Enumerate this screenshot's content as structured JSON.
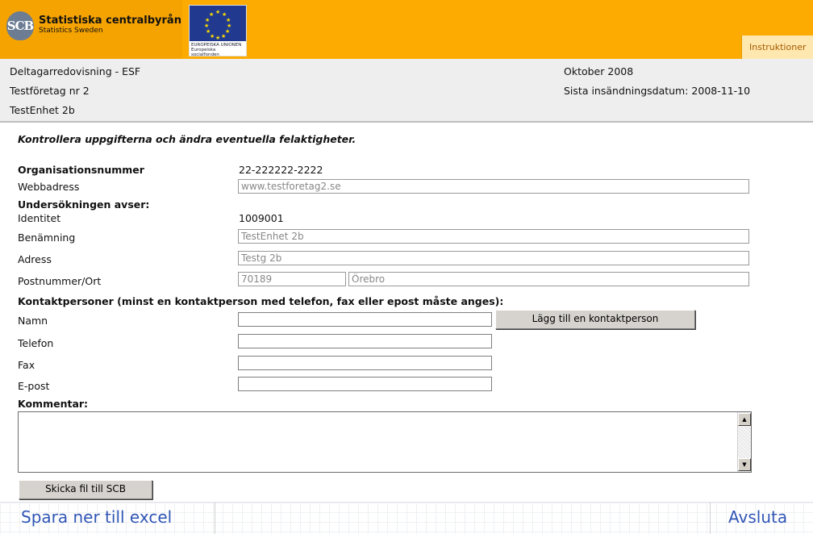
{
  "header": {
    "logo_mark": "SCB",
    "org_name": "Statistiska centralbyrån",
    "org_sub": "Statistics Sweden",
    "eu_text": "EUROPEISKA UNIONEN Europeiska socialfonden",
    "instructions_tab": "Instruktioner",
    "colors": {
      "banner": "#fdab00",
      "eu_blue": "#213a8f",
      "link": "#3056b5"
    }
  },
  "info": {
    "survey": "Deltagarredovisning - ESF",
    "company": "Testföretag nr 2",
    "unit": "TestEnhet 2b",
    "period": "Oktober 2008",
    "deadline": "Sista insändningsdatum: 2008-11-10"
  },
  "form": {
    "intro": "Kontrollera uppgifterna och ändra eventuella felaktigheter.",
    "org_nr_label": "Organisationsnummer",
    "org_nr_value": "22-222222-2222",
    "web_label": "Webbadress",
    "web_value": "www.testforetag2.se",
    "survey_concerns": "Undersökningen avser:",
    "identity_label": "Identitet",
    "identity_value": "1009001",
    "name_label": "Benämning",
    "name_value": "TestEnhet 2b",
    "address_label": "Adress",
    "address_value": "Testg 2b",
    "postal_label": "Postnummer/Ort",
    "postal_code": "70189",
    "city": "Örebro",
    "contacts_heading": "Kontaktpersoner (minst en kontaktperson med telefon, fax eller epost måste anges):",
    "contact_name_label": "Namn",
    "contact_phone_label": "Telefon",
    "contact_fax_label": "Fax",
    "contact_email_label": "E-post",
    "add_contact_button": "Lägg till en kontaktperson",
    "comment_label": "Kommentar:",
    "send_button": "Skicka fil till SCB"
  },
  "footer": {
    "save_excel": "Spara ner till excel",
    "exit": "Avsluta"
  }
}
